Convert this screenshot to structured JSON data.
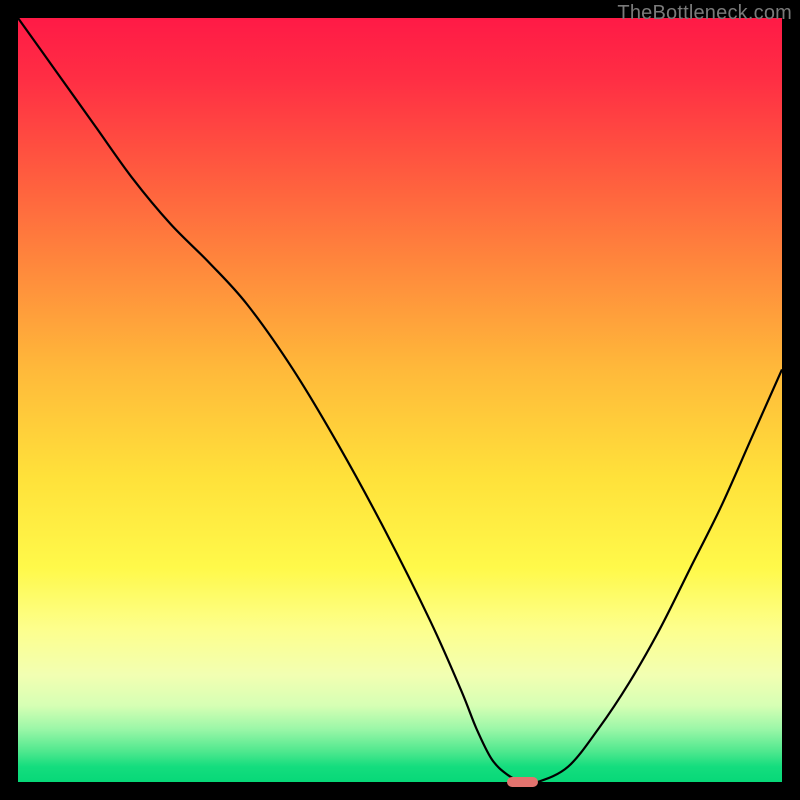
{
  "watermark": "TheBottleneck.com",
  "colors": {
    "frame_bg": "#000000",
    "marker": "#e2736e",
    "curve": "#000000",
    "gradient_top": "#ff1a46",
    "gradient_bottom": "#07d878"
  },
  "chart_data": {
    "type": "line",
    "title": "",
    "xlabel": "",
    "ylabel": "",
    "xlim": [
      0,
      100
    ],
    "ylim": [
      0,
      100
    ],
    "grid": false,
    "series": [
      {
        "name": "bottleneck-curve",
        "x": [
          0,
          5,
          10,
          15,
          20,
          25,
          30,
          36,
          42,
          48,
          54,
          58,
          60,
          62,
          64,
          66,
          68,
          72,
          76,
          80,
          84,
          88,
          92,
          96,
          100
        ],
        "values": [
          100,
          93,
          86,
          79,
          73,
          68,
          62.5,
          54,
          44,
          33,
          21,
          12,
          7,
          3,
          1,
          0,
          0,
          2,
          7,
          13,
          20,
          28,
          36,
          45,
          54
        ]
      }
    ],
    "marker": {
      "x": 66,
      "y": 0,
      "width_pct": 4,
      "height_pct": 1.2
    },
    "annotations": []
  }
}
